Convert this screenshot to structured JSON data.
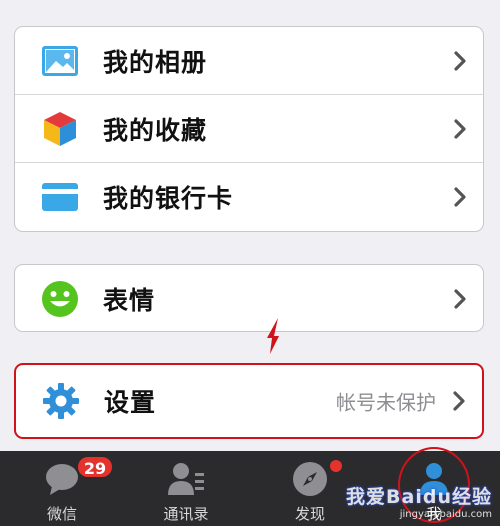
{
  "groups": {
    "main": [
      {
        "label": "我的相册",
        "icon": "album-icon"
      },
      {
        "label": "我的收藏",
        "icon": "favorites-cube-icon"
      },
      {
        "label": "我的银行卡",
        "icon": "bank-card-icon"
      }
    ],
    "emoji": {
      "label": "表情",
      "icon": "smiley-icon"
    },
    "settings": {
      "label": "设置",
      "value": "帐号未保护",
      "icon": "gear-icon"
    }
  },
  "tabbar": {
    "tabs": [
      {
        "label": "微信",
        "badge": "29"
      },
      {
        "label": "通讯录"
      },
      {
        "label": "发现"
      },
      {
        "label": "我"
      }
    ]
  },
  "watermark": {
    "main": "我爱Baidu经验",
    "sub": "jingyan.baidu.com"
  },
  "colors": {
    "highlight": "#d0121b",
    "badge": "#e5322d",
    "tabbar": "#2b2b2d"
  }
}
